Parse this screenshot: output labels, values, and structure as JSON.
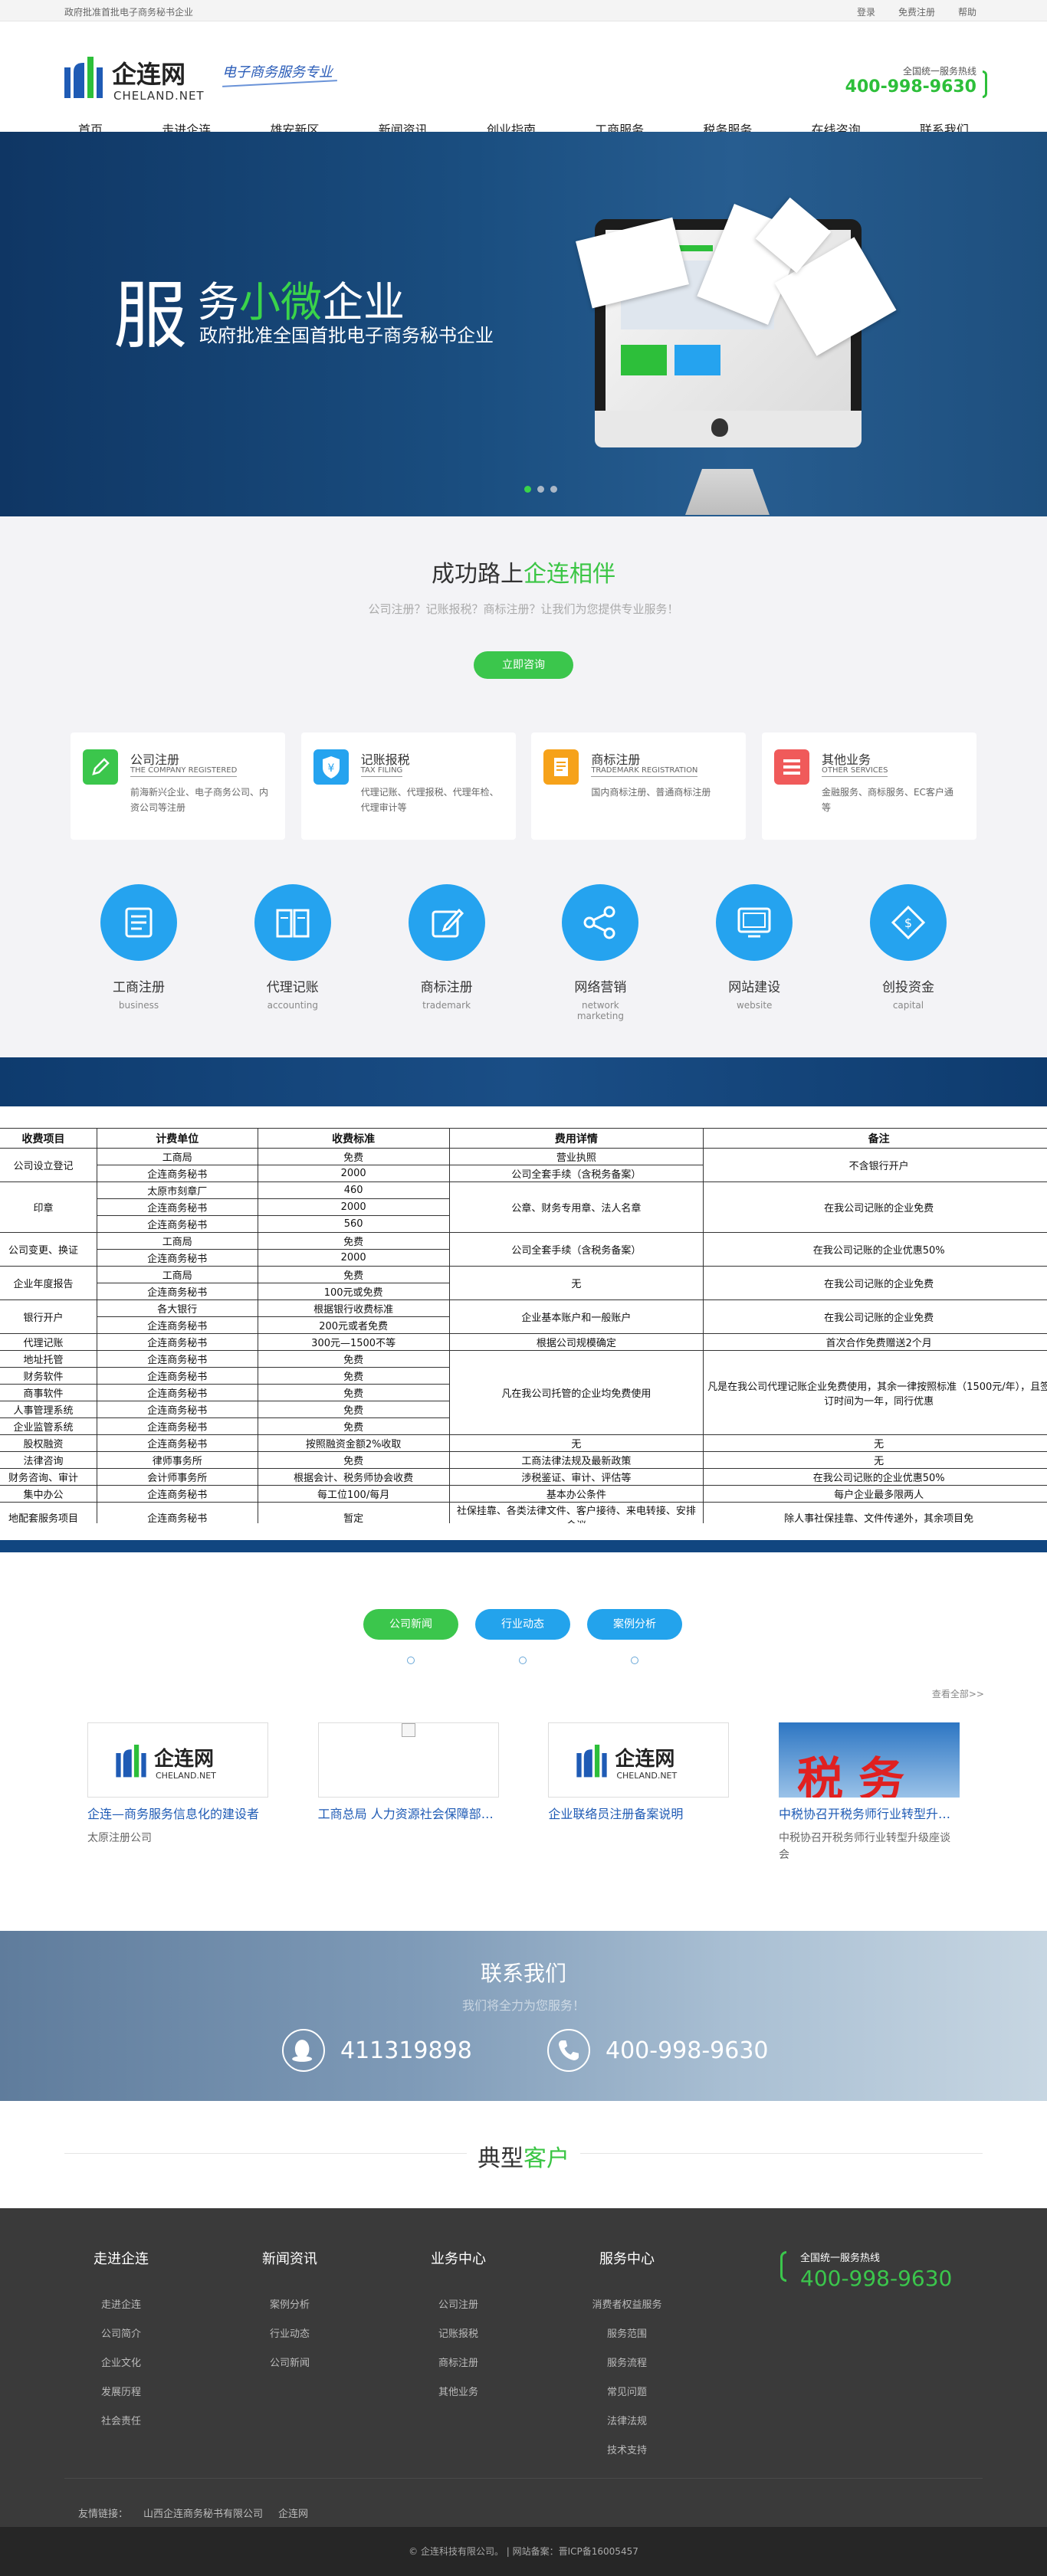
{
  "topbar": {
    "notice": "政府批准首批电子商务秘书企业",
    "links": [
      "登录",
      "免费注册",
      "帮助"
    ]
  },
  "logo": {
    "cn": "企连网",
    "en": "CHELAND.NET",
    "slogan": "电子商务服务专业"
  },
  "hotline": {
    "label": "全国统一服务热线",
    "number": "400-998-9630"
  },
  "nav": [
    "首页",
    "走进企连",
    "雄安新区",
    "新闻资讯",
    "创业指南",
    "工商服务",
    "税务服务",
    "在线咨询",
    "联系我们"
  ],
  "banner": {
    "big": "服",
    "line1a": "务",
    "line1b": "小微",
    "line1c": "企业",
    "line2": "政府批准全国首批电子商务秘书企业"
  },
  "intro": {
    "title_a": "成功路上",
    "title_b": "企连相伴",
    "subtitle": "公司注册？记账报税？商标注册？让我们为您提供专业服务！",
    "button": "立即咨询"
  },
  "cards": [
    {
      "title": "公司注册",
      "en": "THE COMPANY REGISTERED",
      "desc": "前海新兴企业、电子商务公司、内资公司等注册",
      "color": "#3bc64c"
    },
    {
      "title": "记账报税",
      "en": "TAX FILING",
      "desc": "代理记账、代理报税、代理年检、代理审计等",
      "color": "#25a3ef"
    },
    {
      "title": "商标注册",
      "en": "TRADEMARK REGISTRATION",
      "desc": "国内商标注册、普通商标注册",
      "color": "#f6a21a"
    },
    {
      "title": "其他业务",
      "en": "OTHER SERVICES",
      "desc": "金融服务、商标服务、EC客户通等",
      "color": "#f05a5a"
    }
  ],
  "circles": [
    {
      "t": "工商注册",
      "e": "business",
      "icon": "document-icon"
    },
    {
      "t": "代理记账",
      "e": "accounting",
      "icon": "book-icon"
    },
    {
      "t": "商标注册",
      "e": "trademark",
      "icon": "edit-icon"
    },
    {
      "t": "网络营销",
      "e": "network marketing",
      "icon": "share-icon"
    },
    {
      "t": "网站建设",
      "e": "website",
      "icon": "monitor-icon"
    },
    {
      "t": "创投资金",
      "e": "capital",
      "icon": "tag-icon"
    }
  ],
  "fee": {
    "headers": [
      "收费项目",
      "计费单位",
      "收费标准",
      "费用详情",
      "备注"
    ],
    "rows": [
      {
        "item": "公司设立登记",
        "span": 2,
        "sub": [
          [
            "工商局",
            "免费"
          ],
          [
            "企连商务秘书",
            "2000"
          ]
        ],
        "detail": [
          {
            "t": "营业执照",
            "s": 1
          },
          {
            "t": "公司全套手续（含税务备案）",
            "s": 1
          }
        ],
        "note": "不含银行开户"
      },
      {
        "item": "印章",
        "span": 3,
        "sub": [
          [
            "太原市刻章厂",
            "460"
          ],
          [
            "企连商务秘书",
            "2000"
          ],
          [
            "企连商务秘书",
            "560"
          ]
        ],
        "detail": [
          {
            "t": "公章、财务专用章、法人名章",
            "s": 3
          }
        ],
        "note": "在我公司记账的企业免费"
      },
      {
        "item": "公司变更、换证",
        "span": 2,
        "sub": [
          [
            "工商局",
            "免费"
          ],
          [
            "企连商务秘书",
            "2000"
          ]
        ],
        "detail": [
          {
            "t": "公司全套手续（含税务备案）",
            "s": 2
          }
        ],
        "note": "在我公司记账的企业优惠50%"
      },
      {
        "item": "企业年度报告",
        "span": 2,
        "sub": [
          [
            "工商局",
            "免费"
          ],
          [
            "企连商务秘书",
            "100元或免费"
          ]
        ],
        "detail": [
          {
            "t": "无",
            "s": 2
          }
        ],
        "note": "在我公司记账的企业免费"
      },
      {
        "item": "银行开户",
        "span": 2,
        "sub": [
          [
            "各大银行",
            "根据银行收费标准"
          ],
          [
            "企连商务秘书",
            "200元或者免费"
          ]
        ],
        "detail": [
          {
            "t": "企业基本账户和一般账户",
            "s": 2
          }
        ],
        "note": "在我公司记账的企业免费"
      },
      {
        "item": "代理记账",
        "span": 1,
        "sub": [
          [
            "企连商务秘书",
            "300元—1500不等"
          ]
        ],
        "detail": [
          {
            "t": "根据公司规模确定",
            "s": 1
          }
        ],
        "note": "首次合作免费赠送2个月"
      }
    ],
    "managed": {
      "rows": [
        [
          "地址托管",
          "企连商务秘书",
          "免费"
        ],
        [
          "财务软件",
          "企连商务秘书",
          "免费"
        ],
        [
          "商事软件",
          "企连商务秘书",
          "免费"
        ],
        [
          "人事管理系统",
          "企连商务秘书",
          "免费"
        ],
        [
          "企业监管系统",
          "企连商务秘书",
          "免费"
        ]
      ],
      "detail": "凡在我公司托管的企业均免费使用",
      "note": "凡是在我公司代理记账企业免费使用，其余一律按照标准（1500元/年），且签订时间为一年，同行优惠"
    },
    "tail": [
      [
        "股权融资",
        "企连商务秘书",
        "按照融资金额2%收取",
        "无",
        "无"
      ],
      [
        "法律咨询",
        "律师事务所",
        "免费",
        "工商法律法规及最新政策",
        "无"
      ],
      [
        "财务咨询、审计",
        "会计师事务所",
        "根据会计、税务师协会收费",
        "涉税鉴证、审计、评估等",
        "在我公司记账的企业优惠50%"
      ],
      [
        "集中办公",
        "企连商务秘书",
        "每工位100/每月",
        "基本办公条件",
        "每户企业最多限两人"
      ],
      [
        "地配套服务项目",
        "企连商务秘书",
        "暂定",
        "社保挂靠、各类法律文件、客户接待、来电转接、安排会议",
        "除人事社保挂靠、文件传递外，其余项目免"
      ]
    ]
  },
  "news": {
    "tabs": [
      "公司新闻",
      "行业动态",
      "案例分析"
    ],
    "more": "查看全部>>",
    "items": [
      {
        "title": "企连—商务服务信息化的建设者",
        "desc": "太原注册公司",
        "pic": "logo"
      },
      {
        "title": "工商总局 人力资源社会保障部联合印发",
        "desc": "",
        "pic": "broken"
      },
      {
        "title": "企业联络员注册备案说明",
        "desc": "",
        "pic": "logo"
      },
      {
        "title": "中税协召开税务师行业转型升级座谈会",
        "desc": "中税协召开税务师行业转型升级座谈会",
        "pic": "tax",
        "tax_word": "税务"
      }
    ]
  },
  "contact": {
    "title": "联系我们",
    "subtitle": "我们将全力为您服务！",
    "qq": "411319898",
    "phone": "400-998-9630"
  },
  "clients": {
    "a": "典型",
    "b": "客户"
  },
  "footer": {
    "cols": [
      {
        "h": "走进企连",
        "items": [
          "走进企连",
          "公司简介",
          "企业文化",
          "发展历程",
          "社会责任"
        ]
      },
      {
        "h": "新闻资讯",
        "items": [
          "案例分析",
          "行业动态",
          "公司新闻"
        ]
      },
      {
        "h": "业务中心",
        "items": [
          "公司注册",
          "记账报税",
          "商标注册",
          "其他业务"
        ]
      },
      {
        "h": "服务中心",
        "items": [
          "消费者权益服务",
          "服务范围",
          "服务流程",
          "常见问题",
          "法律法规",
          "技术支持"
        ]
      }
    ],
    "hot_label": "全国统一服务热线",
    "hot_number": "400-998-9630",
    "links_label": "友情链接：",
    "links": [
      "山西企连商务秘书有限公司",
      "企连网"
    ],
    "copyright": "© 企连科技有限公司。 | 网站备案：晋ICP备16005457"
  },
  "colors": {
    "green": "#3bc64c",
    "blue": "#25a3ef",
    "navy": "#0f3664"
  }
}
